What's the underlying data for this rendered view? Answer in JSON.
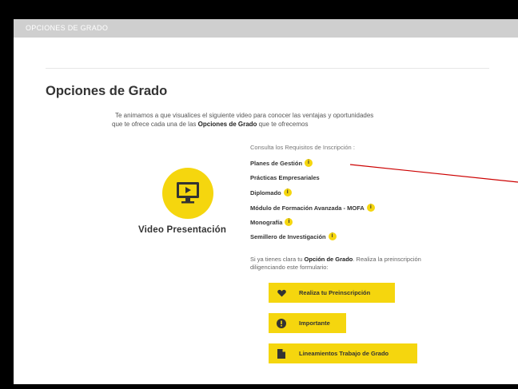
{
  "breadcrumb": "OPCIONES DE GRADO",
  "page_title": "Opciones de Grado",
  "intro": {
    "line1": "Te animamos a que visualices el siguiente video para conocer las ventajas y oportunidades",
    "line2_prefix": "que te ofrece cada una de las ",
    "line2_bold": "Opciones de Grado",
    "line2_suffix": " que te ofrecemos"
  },
  "video": {
    "label": "Video Presentación",
    "icon": "monitor-play-icon"
  },
  "requirements": {
    "heading": "Consulta los Requisitos de Inscripción :",
    "items": [
      {
        "label": "Planes de Gestión",
        "info": true
      },
      {
        "label": "Prácticas Empresariales",
        "info": false
      },
      {
        "label": "Diplomado",
        "info": true
      },
      {
        "label": "Módulo de Formación Avanzada - MOFA",
        "info": true
      },
      {
        "label": "Monografía",
        "info": true
      },
      {
        "label": "Semillero de Investigación",
        "info": true
      }
    ],
    "info_glyph": "i"
  },
  "note": {
    "prefix": "Si ya tienes clara tu ",
    "bold": "Opción de Grado",
    "suffix": ". Realiza la preinscripción diligenciando este formulario:"
  },
  "buttons": {
    "preinscripcion": "Realiza tu Preinscripción",
    "importante": "Importante",
    "lineamientos": "Lineamientos Trabajo de Grado"
  },
  "colors": {
    "accent": "#f5d60e",
    "annotation": "#cc0000"
  }
}
